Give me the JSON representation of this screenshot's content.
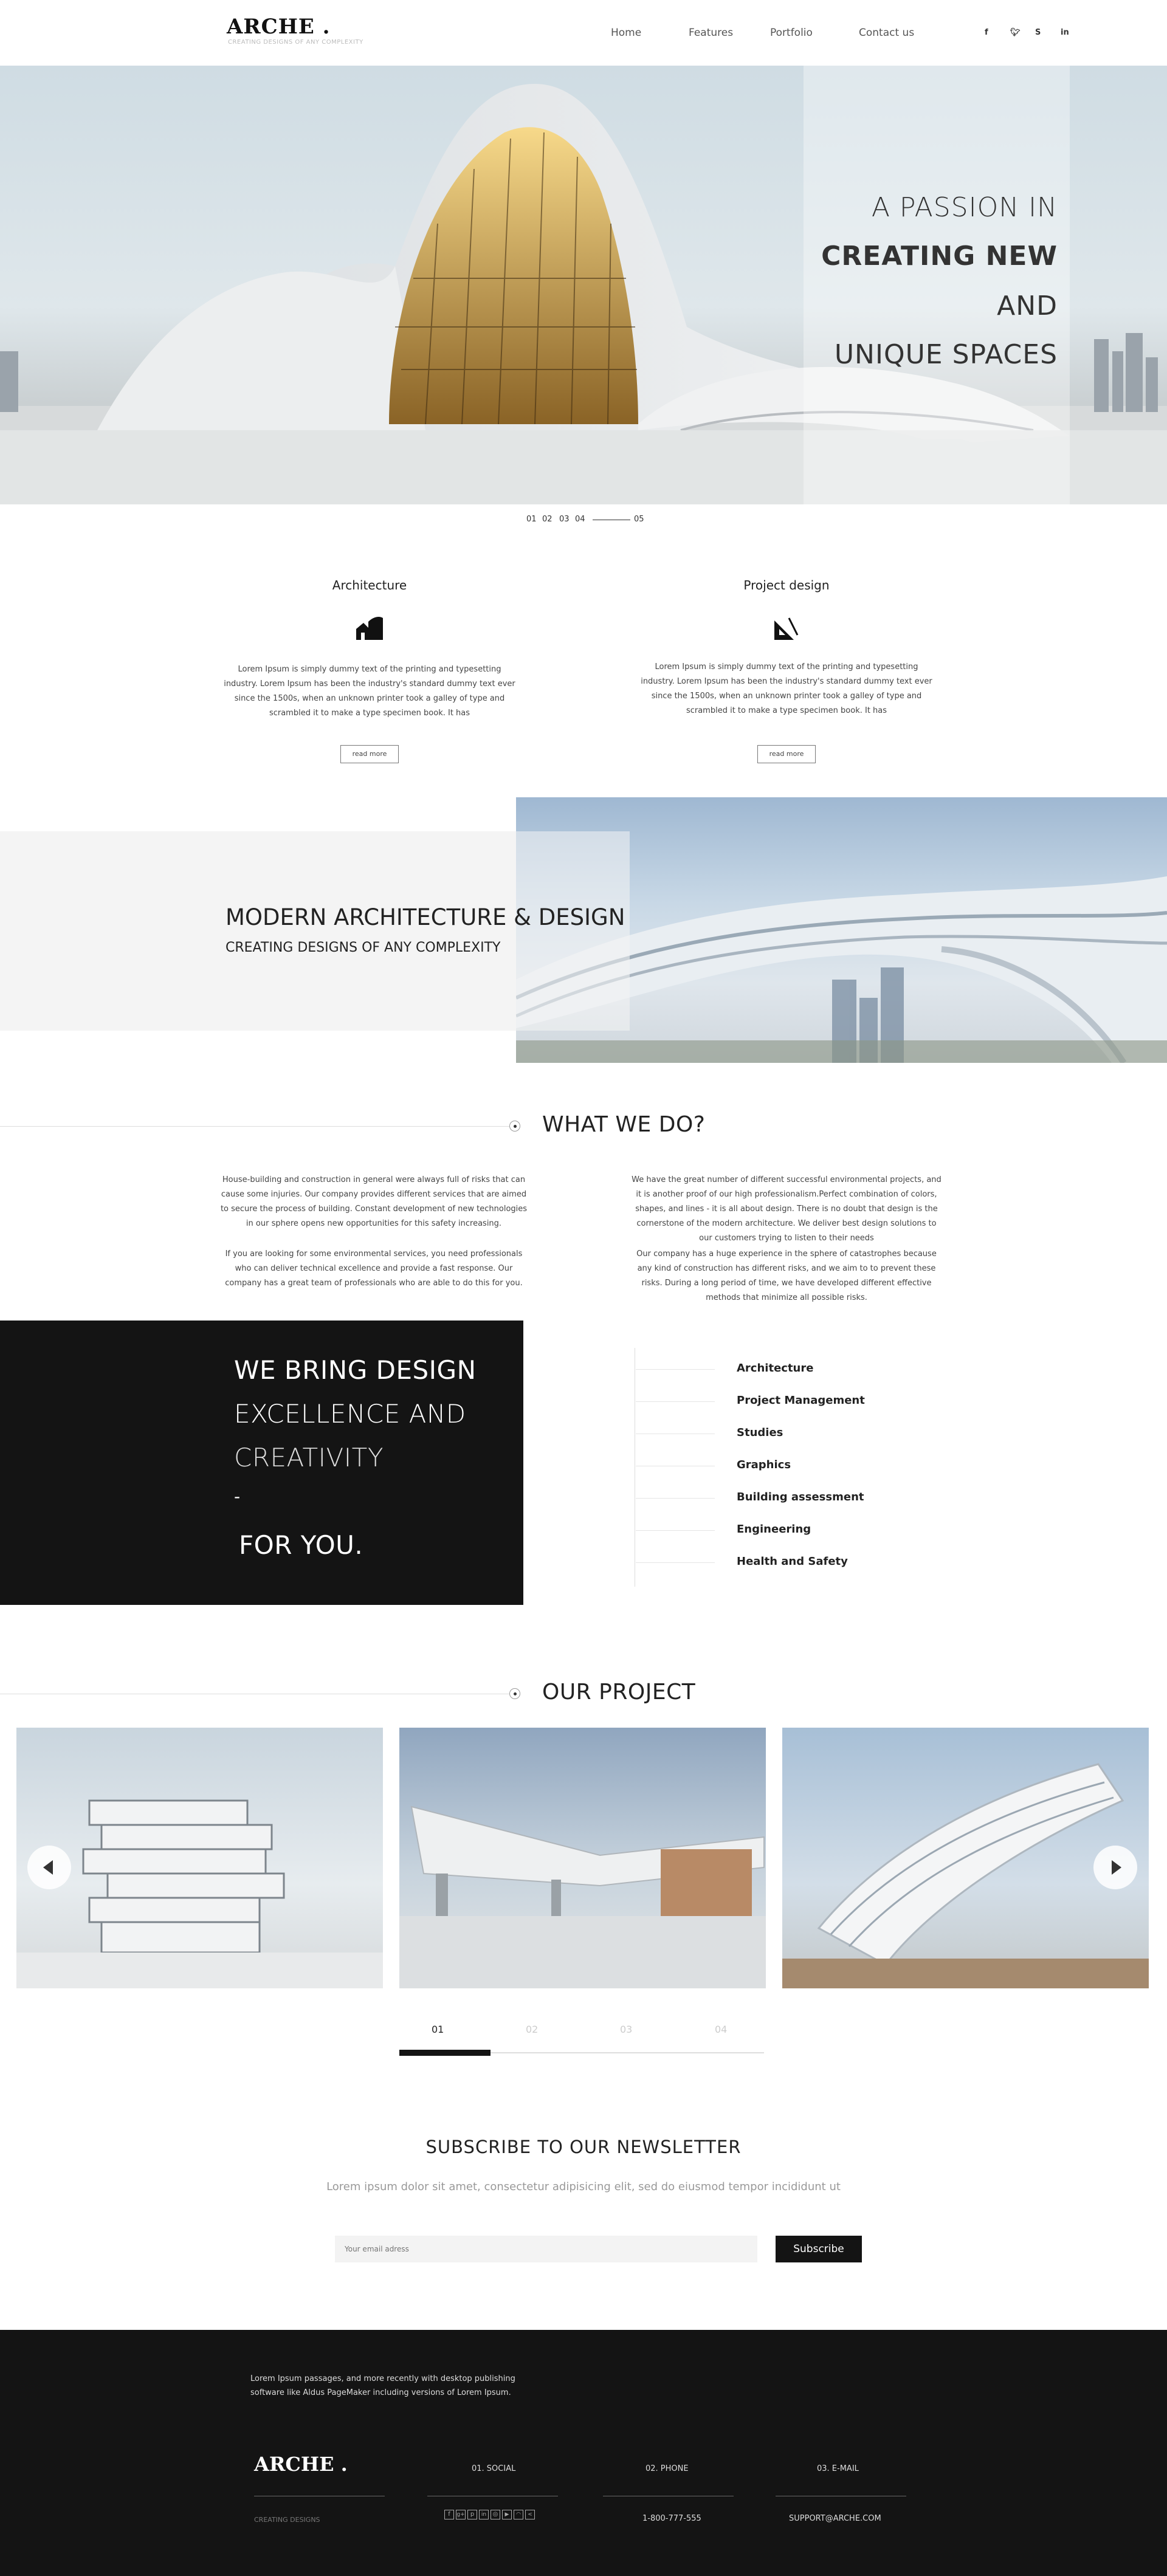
{
  "header": {
    "logo": "ARCHE .",
    "tagline": "CREATING DESIGNS OF ANY COMPLEXITY",
    "nav": [
      "Home",
      "Features",
      "Portfolio",
      "Contact us"
    ],
    "social_icons": [
      "facebook-icon",
      "twitter-icon",
      "skype-icon",
      "linkedin-icon"
    ]
  },
  "hero": {
    "line1": "A PASSION IN",
    "line2": "CREATING NEW",
    "line3": "AND",
    "line4": "UNIQUE SPACES",
    "pager": [
      "01",
      "02",
      "03",
      "04",
      "05"
    ]
  },
  "services": [
    {
      "title": "Architecture",
      "icon": "buildings-icon",
      "text": "Lorem Ipsum is simply dummy text of the printing and typesetting industry. Lorem Ipsum has been the industry's standard dummy text ever since the 1500s, when an unknown printer took a galley of type and scrambled it to make a type specimen book. It has",
      "button": "read more"
    },
    {
      "title": "Project design",
      "icon": "triangle-ruler-icon",
      "text": "Lorem Ipsum is simply dummy text of the printing and typesetting industry. Lorem Ipsum has been the industry's standard dummy text ever since the 1500s, when an unknown printer took a galley of type and scrambled it to make a type specimen book. It has",
      "button": "read more"
    }
  ],
  "modern": {
    "title": "MODERN  ARCHITECTURE & DESIGN",
    "subtitle": "CREATING DESIGNS OF ANY COMPLEXITY"
  },
  "what_we_do": {
    "heading": "WHAT WE DO?",
    "left_p1": "House-building and construction in general were always full of risks that can cause some injuries. Our company provides different services that are aimed to secure the process of building. Constant development of new technologies in our sphere opens new opportunities for this safety increasing.",
    "left_p2": "If you are looking for some environmental services, you need professionals who can deliver technical excellence and provide a fast response. Our company has a great team of professionals who are able to do this for you.",
    "right_p1": "We have the great number of different successful environmental projects, and it is another proof of our high professionalism.Perfect combination of colors, shapes, and lines - it is all about design. There is no doubt that design is the cornerstone of the modern architecture. We deliver best design solutions to our customers trying to listen to their needs",
    "right_p2": "Our company has a huge experience in the sphere of catastrophes because any kind of construction has different risks, and we aim to to prevent these risks. During a long period of time, we have developed different effective methods that minimize all possible risks."
  },
  "bring": {
    "line1": "WE BRING DESIGN",
    "line2": "EXCELLENCE AND",
    "line3": "CREATIVITY",
    "line4": "-",
    "line5": "FOR YOU."
  },
  "services_list": [
    "Architecture",
    "Project Management",
    "Studies",
    "Graphics",
    "Building assessment",
    "Engineering",
    "Health and Safety"
  ],
  "projects": {
    "heading": "OUR PROJECT",
    "tabs": [
      "01",
      "02",
      "03",
      "04"
    ],
    "active_tab_fraction": 0.25
  },
  "newsletter": {
    "heading": "SUBSCRIBE TO OUR NEWSLETTER",
    "subheading": "Lorem ipsum dolor sit amet, consectetur adipisicing elit, sed do eiusmod tempor incididunt ut",
    "placeholder": "Your email adress",
    "button": "Subscribe"
  },
  "footer": {
    "blurb_line1": "Lorem Ipsum passages, and more recently with desktop publishing",
    "blurb_line2": "software like Aldus PageMaker including versions of Lorem Ipsum.",
    "logo": "ARCHE .",
    "logo_sub": "CREATING DESIGNS",
    "col1_title": "01. SOCIAL",
    "col2_title": "02.  PHONE",
    "col2_value": "1-800-777-555",
    "col3_title": "03.  E-MAIL",
    "col3_value": "SUPPORT@ARCHE.COM",
    "social_icons": [
      "facebook-icon",
      "google-plus-icon",
      "pinterest-icon",
      "linkedin-icon",
      "dribbble-icon",
      "youtube-icon",
      "rss-icon",
      "share-icon"
    ]
  }
}
